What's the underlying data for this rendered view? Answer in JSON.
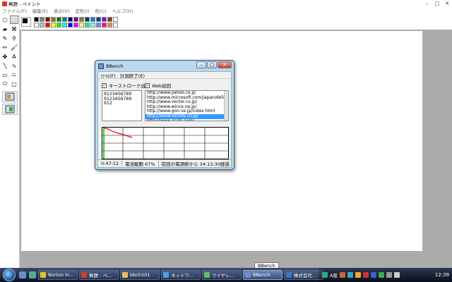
{
  "window": {
    "title": "無題 - ペイント",
    "controls": {
      "minimize": "–",
      "maximize": "□",
      "close": "✕"
    }
  },
  "menubar": [
    "ファイル(F)",
    "編集(E)",
    "表示(V)",
    "変形(I)",
    "色(C)",
    "ヘルプ(H)"
  ],
  "tools": [
    {
      "name": "free-select-icon",
      "glyph": "⬠"
    },
    {
      "name": "rect-select-icon",
      "glyph": "⬚"
    },
    {
      "name": "eraser-icon",
      "glyph": "▰"
    },
    {
      "name": "fill-icon",
      "glyph": "⌘"
    },
    {
      "name": "color-picker-icon",
      "glyph": "✎"
    },
    {
      "name": "magnifier-icon",
      "glyph": "⚲"
    },
    {
      "name": "pencil-icon",
      "glyph": "✏"
    },
    {
      "name": "brush-icon",
      "glyph": "🖌"
    },
    {
      "name": "airbrush-icon",
      "glyph": "✤"
    },
    {
      "name": "text-icon",
      "glyph": "A"
    },
    {
      "name": "line-icon",
      "glyph": "╲"
    },
    {
      "name": "curve-icon",
      "glyph": "∿"
    },
    {
      "name": "rectangle-icon",
      "glyph": "▭"
    },
    {
      "name": "polygon-icon",
      "glyph": "⏢"
    },
    {
      "name": "ellipse-icon",
      "glyph": "⬭"
    },
    {
      "name": "rounded-rect-icon",
      "glyph": "▢"
    }
  ],
  "palette": {
    "top": [
      "#000000",
      "#808080",
      "#800000",
      "#808000",
      "#008000",
      "#008080",
      "#000080",
      "#800080",
      "#808040",
      "#004040",
      "#0080ff",
      "#004080",
      "#8000ff",
      "#804000",
      "#ffffff"
    ],
    "bottom": [
      "#ffffff",
      "#c0c0c0",
      "#ff0000",
      "#ffff00",
      "#00ff00",
      "#00ffff",
      "#0000ff",
      "#ff00ff",
      "#ffff80",
      "#00ff80",
      "#80ffff",
      "#8080ff",
      "#ff0080",
      "#ff8040",
      "#ffffff"
    ]
  },
  "bbench": {
    "title": "BBench",
    "menu": [
      "ﾌｧｲﾙ(F)",
      "計測終了(E)"
    ],
    "keystroke_label": "キーストローク出力",
    "web_label": "Web巡回",
    "check_mark": "✓",
    "keystroke_text": "0123456789\n0123456789\n012",
    "urls": [
      "http://www.yahoo.co.jp",
      "http://www.microsoft.com/japan/default.",
      "http://www.vector.co.jp/",
      "http://www.wince.ne.jp/",
      "http://www.goo.ne.jp/index.html",
      "http://www.hinode.co.jp/",
      "http://www.asahi.com/"
    ],
    "selected_url_index": 5,
    "status": {
      "elapsed": "0:47:12",
      "battery": "電池駆動  67%",
      "since_power": "前回の電源断から 34:13:30経過"
    }
  },
  "taskbar": {
    "tasks": [
      {
        "label": "Norton In...",
        "color": "#f0c020"
      },
      {
        "label": "無題 - ペ...",
        "color": "#d04020"
      },
      {
        "label": "bbch101",
        "color": "#e8c060"
      },
      {
        "label": "ネットワ...",
        "color": "#4aa0e0"
      },
      {
        "label": "ワイヤレ...",
        "color": "#60c060"
      },
      {
        "label": "BBench",
        "color": "#6c8ed0"
      },
      {
        "label": "株式会社...",
        "color": "#3a78d0"
      }
    ],
    "active_index": 5,
    "tray_label": "A般",
    "clock": "12:39",
    "tooltip": "BBench"
  }
}
